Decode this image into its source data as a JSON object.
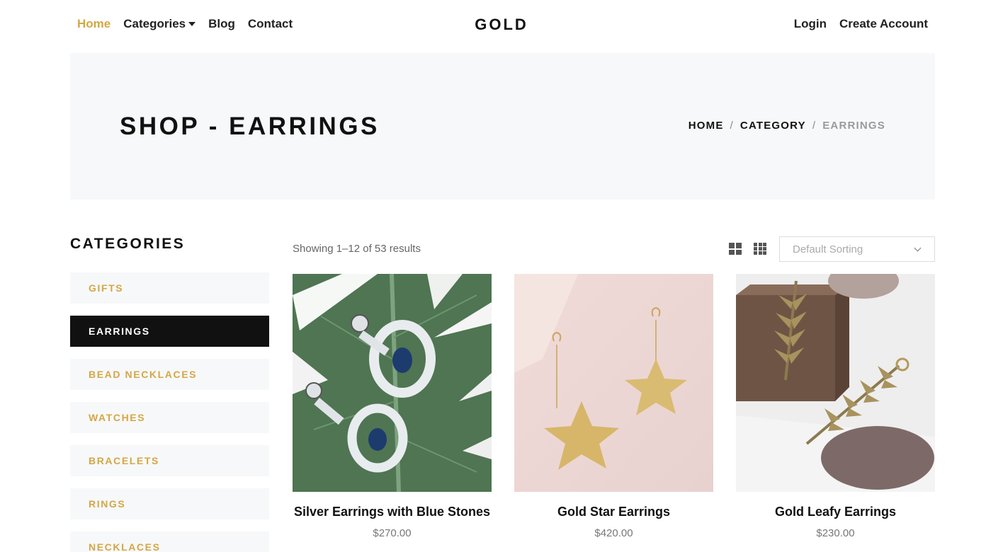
{
  "nav": {
    "links": [
      {
        "label": "Home",
        "active": true
      },
      {
        "label": "Categories",
        "dropdown": true
      },
      {
        "label": "Blog"
      },
      {
        "label": "Contact"
      }
    ],
    "logo": "GOLD",
    "right_links": [
      "Login",
      "Create Account"
    ]
  },
  "hero": {
    "title": "SHOP - EARRINGS",
    "breadcrumb": [
      "HOME",
      "CATEGORY",
      "EARRINGS"
    ]
  },
  "sidebar": {
    "title": "CATEGORIES",
    "items": [
      "GIFTS",
      "EARRINGS",
      "BEAD NECKLACES",
      "WATCHES",
      "BRACELETS",
      "RINGS",
      "NECKLACES"
    ],
    "active_item": "EARRINGS"
  },
  "toolbar": {
    "results_text": "Showing 1–12 of 53 results",
    "sort_placeholder": "Default Sorting"
  },
  "products": [
    {
      "name": "Silver Earrings with Blue Stones",
      "price": "$270.00"
    },
    {
      "name": "Gold Star Earrings",
      "price": "$420.00"
    },
    {
      "name": "Gold Leafy Earrings",
      "price": "$230.00"
    }
  ],
  "colors": {
    "accent": "#d4a745",
    "dark": "#111111",
    "hero_bg": "#f7f8f9"
  }
}
